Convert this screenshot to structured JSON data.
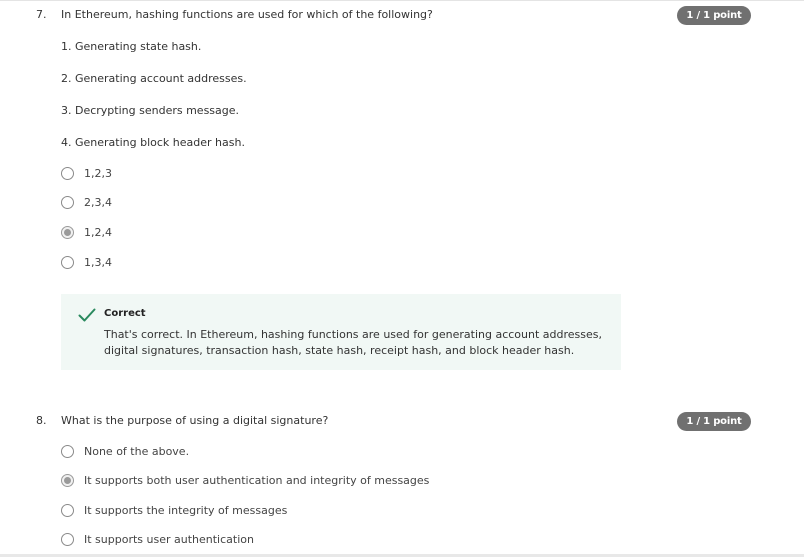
{
  "q7": {
    "number": "7.",
    "text": "In Ethereum, hashing functions are used for which of the following?",
    "points": "1 / 1 point",
    "statements": [
      "1. Generating state hash.",
      "2. Generating account addresses.",
      "3. Decrypting senders message.",
      "4. Generating block header hash."
    ],
    "options": [
      "1,2,3",
      "2,3,4",
      "1,2,4",
      "1,3,4"
    ],
    "selected_index": 2,
    "feedback": {
      "title": "Correct",
      "text": "That's correct. In Ethereum, hashing functions are used for generating account addresses, digital signatures, transaction hash, state hash, receipt hash, and block header hash.",
      "icon": "check-icon",
      "color": "#2a8a5e"
    }
  },
  "q8": {
    "number": "8.",
    "text": "What is the purpose of using a digital signature?",
    "points": "1 / 1 point",
    "options": [
      "None of the above.",
      "It supports both user authentication and integrity of messages",
      "It supports the integrity of messages",
      "It supports user authentication"
    ],
    "selected_index": 1
  }
}
